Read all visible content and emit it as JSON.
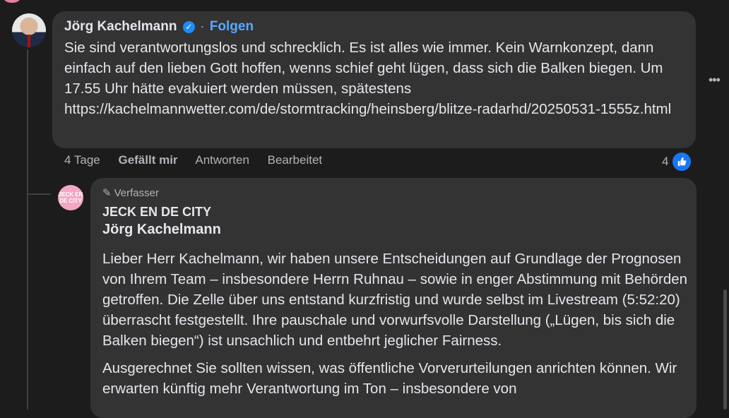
{
  "comment": {
    "author": "Jörg Kachelmann",
    "verified_icon": "verified-badge-icon",
    "separator": "·",
    "follow_label": "Folgen",
    "text": "Sie sind verantwortungslos und schrecklich. Es ist alles wie immer. Kein Warnkonzept, dann einfach auf den lieben Gott hoffen, wenns schief geht lügen, dass sich die Balken biegen. Um 17.55 Uhr hätte evakuiert werden müssen, spätestens https://kachelmannwetter.com/de/stormtracking/heinsberg/blitze-radarhd/20250531-1555z.html",
    "time": "4 Tage",
    "like_label": "Gefällt mir",
    "reply_label": "Antworten",
    "edited_label": "Bearbeitet",
    "reaction_count": "4"
  },
  "reply": {
    "badge_label": "Verfasser",
    "page_name": "JECK EN DE CITY",
    "mention": "Jörg Kachelmann",
    "paragraph1": "Lieber Herr Kachelmann, wir haben unsere Entscheidungen auf Grundlage der Prognosen von Ihrem Team – insbesondere Herrn Ruhnau – sowie in enger Abstimmung mit Behörden getroffen. Die Zelle über uns entstand kurzfristig und wurde selbst im Livestream (5:52:20) überrascht festgestellt. Ihre pauschale und vorwurfsvolle Darstellung („Lügen, bis sich die Balken biegen“) ist unsachlich und entbehrt jeglicher Fairness.",
    "paragraph2": "Ausgerechnet Sie sollten wissen, was öffentliche Vorverurteilungen anrichten können. Wir erwarten künftig mehr Verantwortung im Ton – insbesondere von",
    "avatar_text": "JECK EN DE CITY"
  },
  "colors": {
    "background": "#1c1c1d",
    "bubble": "#333334",
    "link": "#5aa7ff",
    "like": "#1877f2"
  }
}
